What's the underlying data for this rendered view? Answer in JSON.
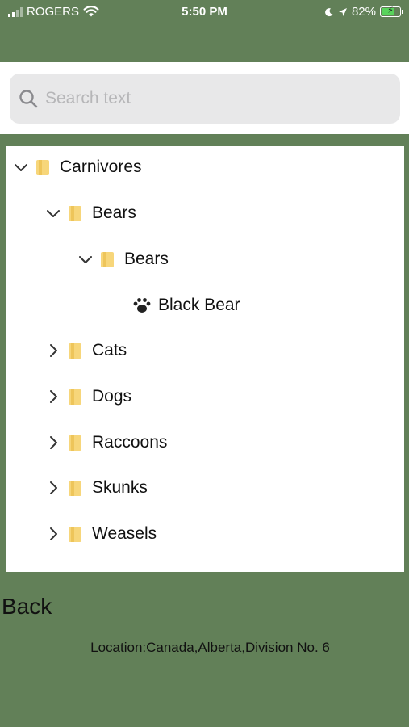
{
  "status_bar": {
    "carrier": "ROGERS",
    "time": "5:50 PM",
    "battery_percent": "82%",
    "battery_level": 0.82,
    "battery_color": "#59d35c"
  },
  "search": {
    "placeholder": "Search text",
    "value": ""
  },
  "tree": {
    "root": {
      "label": "Carnivores",
      "expanded": true,
      "icon": "folder-icon"
    },
    "bears_group": {
      "label": "Bears",
      "expanded": true
    },
    "bears_subgroup": {
      "label": "Bears",
      "expanded": true
    },
    "black_bear": {
      "label": "Black Bear",
      "icon": "paw-icon"
    },
    "collapsed_items": [
      {
        "label": "Cats"
      },
      {
        "label": "Dogs"
      },
      {
        "label": "Raccoons"
      },
      {
        "label": "Skunks"
      },
      {
        "label": "Weasels"
      }
    ]
  },
  "footer": {
    "back_label": "Back",
    "location_text": "Location:Canada,Alberta,Division No. 6"
  },
  "colors": {
    "background": "#628058",
    "panel": "#ffffff",
    "search_field": "#e8e8e9",
    "folder": "#f7d67a"
  }
}
